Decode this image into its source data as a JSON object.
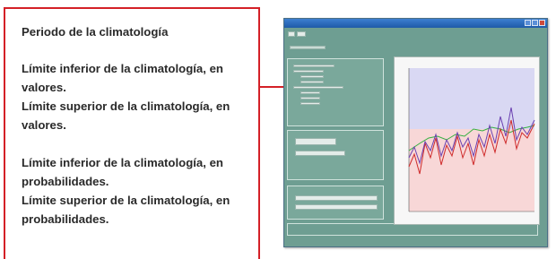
{
  "callout": {
    "line1": "Periodo de la climatología",
    "line2a": "Límite inferior de la climatología, en",
    "line2b": "valores.",
    "line3a": "Límite superior de la climatología, en",
    "line3b": "valores.",
    "line4a": "Límite inferior de la climatología, en",
    "line4b": "probabilidades.",
    "line5a": "Límite superior de la climatología, en",
    "line5b": "probabilidades."
  },
  "colors": {
    "accent_red": "#d42027",
    "window_bg": "#6e9e92",
    "band_upper": "#d9d8f3",
    "band_lower": "#f8d7d7",
    "series_red": "#cf2b2b",
    "series_purple": "#6a40b0",
    "series_green": "#34b040"
  },
  "icons": {
    "minimize": "minimize-icon",
    "maximize": "maximize-icon",
    "close": "close-icon"
  }
}
